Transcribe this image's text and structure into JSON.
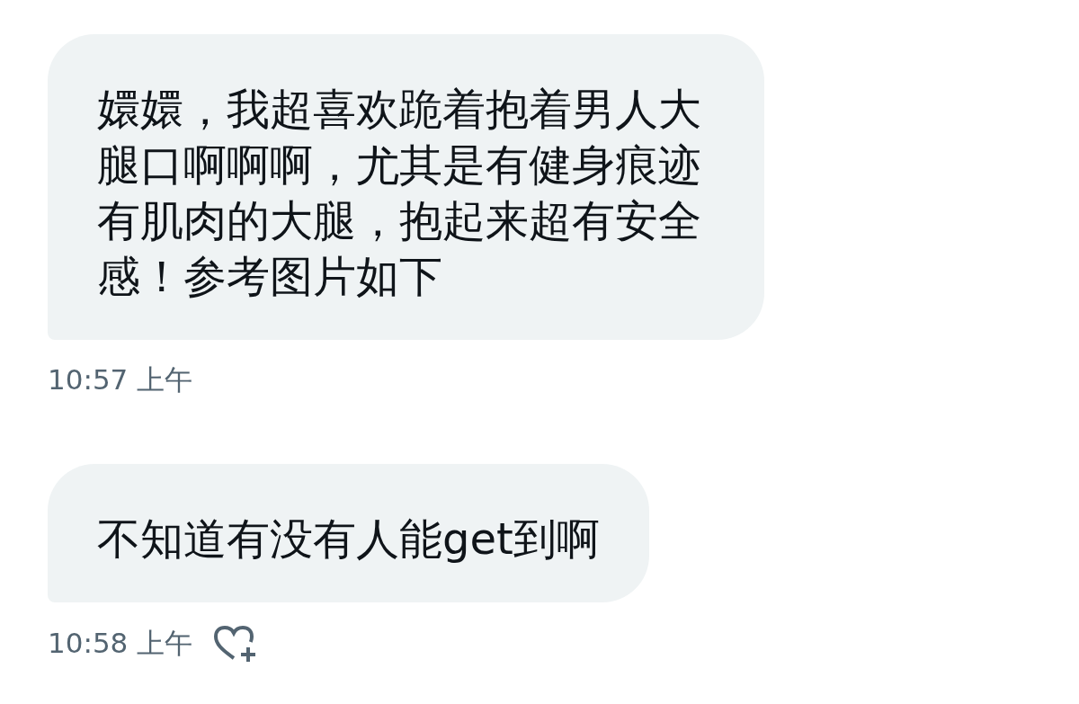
{
  "messages": [
    {
      "text": "嬛嬛，我超喜欢跪着抱着男人大腿口啊啊啊，尤其是有健身痕迹有肌肉的大腿，抱起来超有安全感！参考图片如下",
      "time": "10:57 上午",
      "reaction_button": false
    },
    {
      "text": "不知道有没有人能get到啊",
      "time": "10:58 上午",
      "reaction_button": true
    }
  ]
}
